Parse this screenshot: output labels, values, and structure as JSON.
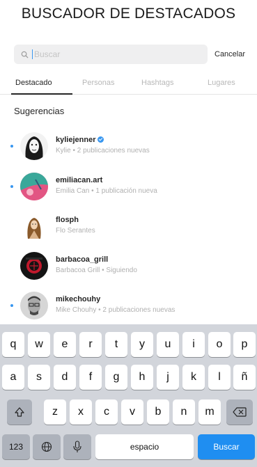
{
  "title": "BUSCADOR DE DESTACADOS",
  "search": {
    "placeholder": "Buscar",
    "cancel_label": "Cancelar"
  },
  "tabs": [
    {
      "label": "Destacado",
      "active": true
    },
    {
      "label": "Personas",
      "active": false
    },
    {
      "label": "Hashtags",
      "active": false
    },
    {
      "label": "Lugares",
      "active": false
    }
  ],
  "suggestions": {
    "heading": "Sugerencias",
    "items": [
      {
        "username": "kyliejenner",
        "subtitle": "Kylie • 2 publicaciones nuevas",
        "verified": true,
        "new_indicator": true
      },
      {
        "username": "emiliacan.art",
        "subtitle": "Emilia Can • 1 publicación nueva",
        "verified": false,
        "new_indicator": true
      },
      {
        "username": "flosph",
        "subtitle": "Flo Serantes",
        "verified": false,
        "new_indicator": false
      },
      {
        "username": "barbacoa_grill",
        "subtitle": "Barbacoa Grill • Siguiendo",
        "verified": false,
        "new_indicator": false
      },
      {
        "username": "mikechouhy",
        "subtitle": "Mike Chouhy • 2 publicaciones nuevas",
        "verified": false,
        "new_indicator": true
      }
    ]
  },
  "keyboard": {
    "row1": [
      "q",
      "w",
      "e",
      "r",
      "t",
      "y",
      "u",
      "i",
      "o",
      "p"
    ],
    "row2": [
      "a",
      "s",
      "d",
      "f",
      "g",
      "h",
      "j",
      "k",
      "l",
      "ñ"
    ],
    "row3": [
      "z",
      "x",
      "c",
      "v",
      "b",
      "n",
      "m"
    ],
    "numbers_label": "123",
    "space_label": "espacio",
    "search_label": "Buscar"
  },
  "colors": {
    "accent": "#3897f0",
    "search_key": "#1f8ef1",
    "keyboard_bg": "#d2d5db"
  },
  "icons": [
    "search-icon",
    "verified-badge-icon",
    "shift-icon",
    "backspace-icon",
    "globe-icon",
    "microphone-icon"
  ]
}
